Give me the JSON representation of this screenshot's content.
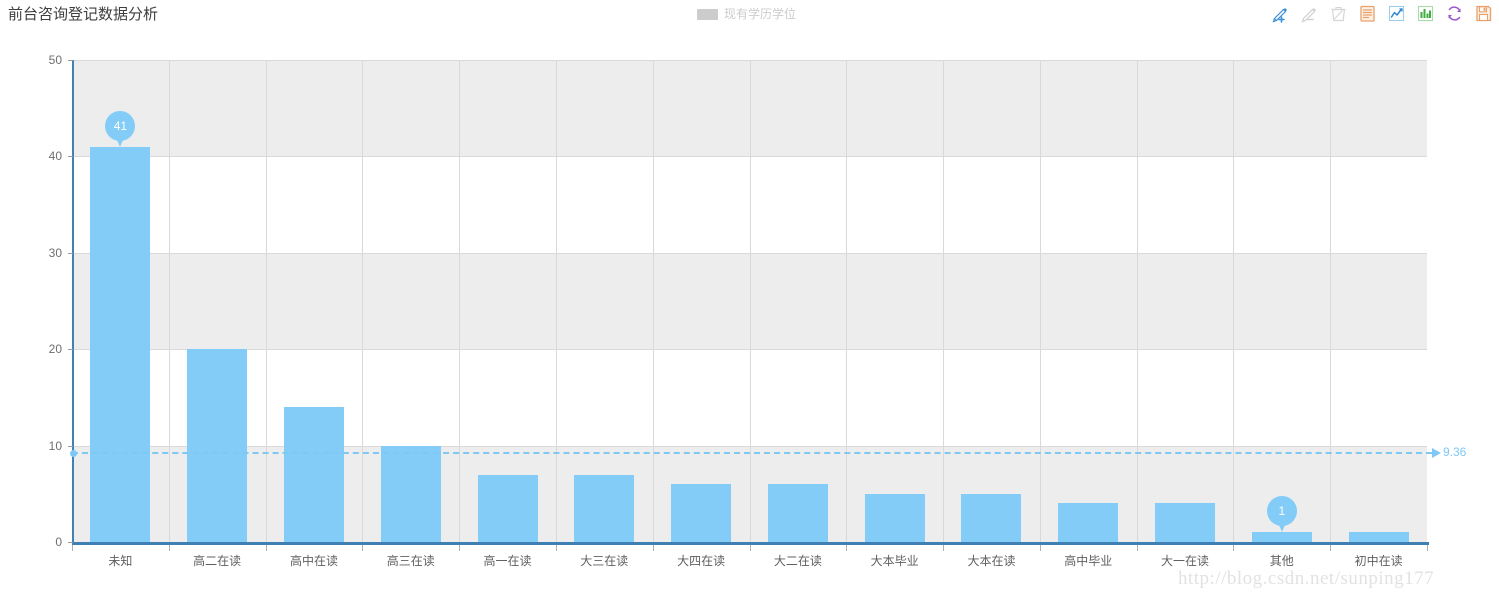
{
  "header": {
    "title": "前台咨询登记数据分析",
    "legend": {
      "label": "现有学历学位",
      "swatch_color": "#cccccc"
    },
    "toolbar": [
      {
        "name": "pencil-add-icon",
        "label": "新增",
        "color": "#3d8fd6",
        "enabled": true
      },
      {
        "name": "pencil-minus-icon",
        "label": "删除编辑",
        "color": "#d0d0d0",
        "enabled": false
      },
      {
        "name": "trash-icon",
        "label": "删除",
        "color": "#d6d6d6",
        "enabled": false
      },
      {
        "name": "list-document-icon",
        "label": "列表",
        "color": "#e8a06a",
        "enabled": true
      },
      {
        "name": "line-chart-icon",
        "label": "折线图",
        "color": "#4aa3e0",
        "enabled": true
      },
      {
        "name": "bar-chart-icon",
        "label": "柱状图",
        "color": "#4fb84f",
        "enabled": true
      },
      {
        "name": "refresh-icon",
        "label": "刷新",
        "color": "#9b59d0",
        "enabled": true
      },
      {
        "name": "save-icon",
        "label": "保存",
        "color": "#e8a06a",
        "enabled": true
      }
    ]
  },
  "chart_data": {
    "type": "bar",
    "title": "前台咨询登记数据分析",
    "xlabel": "",
    "ylabel": "",
    "ylim": [
      0,
      50
    ],
    "yticks": [
      0,
      10,
      20,
      30,
      40,
      50
    ],
    "grid": true,
    "legend_position": "top-center",
    "series_name": "现有学历学位",
    "bar_color": "#82ccf7",
    "categories": [
      "未知",
      "高二在读",
      "高中在读",
      "高三在读",
      "高一在读",
      "大三在读",
      "大四在读",
      "大二在读",
      "大本毕业",
      "大本在读",
      "高中毕业",
      "大一在读",
      "其他",
      "初中在读"
    ],
    "values": [
      41,
      20,
      14,
      10,
      7,
      7,
      6,
      6,
      5,
      5,
      4,
      4,
      1,
      1
    ],
    "annotations": {
      "max": {
        "label": "41",
        "category": "未知",
        "value": 41
      },
      "min": {
        "label": "1",
        "category": "其他",
        "value": 1
      },
      "average": {
        "label": "9.36",
        "value": 9.36,
        "color": "#7ec8f5",
        "style": "dashed"
      }
    }
  },
  "watermark": {
    "text": "http://blog.csdn.net/sunping177"
  }
}
